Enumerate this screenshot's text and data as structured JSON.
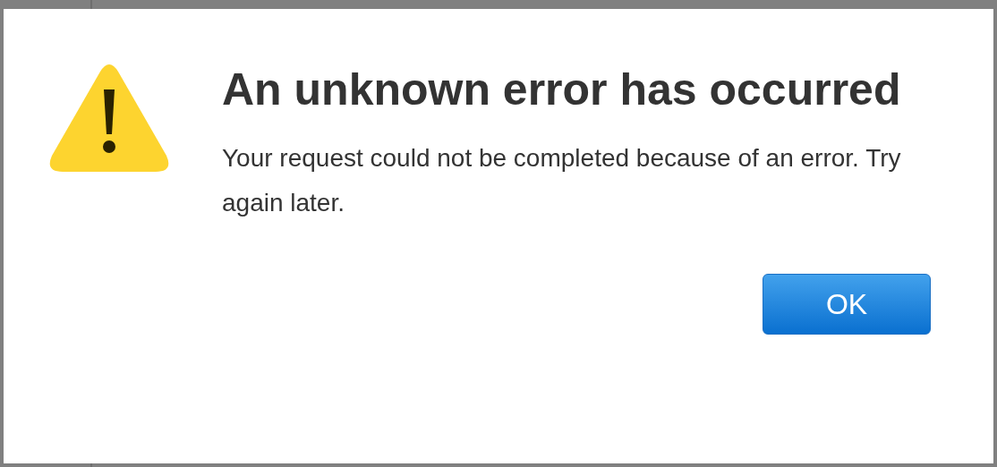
{
  "dialog": {
    "title": "An unknown error has occurred",
    "message": "Your request could not be completed because of an error. Try again later.",
    "buttons": [
      {
        "label": "OK",
        "kind": "default"
      }
    ]
  }
}
